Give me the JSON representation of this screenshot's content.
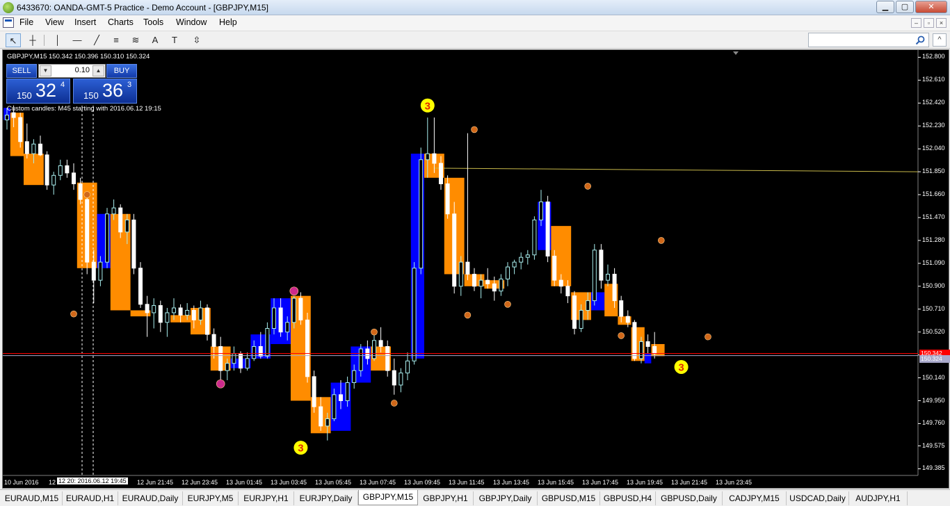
{
  "window": {
    "title": "6433670: OANDA-GMT-5 Practice - Demo Account - [GBPJPY,M15]",
    "min": "▁",
    "max": "▢",
    "close": "✕"
  },
  "menu": {
    "items": [
      "File",
      "View",
      "Insert",
      "Charts",
      "Tools",
      "Window",
      "Help"
    ],
    "mdi": [
      "–",
      "▫",
      "×"
    ]
  },
  "toolbar": {
    "tools": [
      "cursor-icon",
      "crosshair-icon",
      "vertical-line-icon",
      "horizontal-line-icon",
      "trendline-icon",
      "channel-icon",
      "fibonacci-icon",
      "text-icon",
      "label-icon",
      "arrows-icon"
    ],
    "tool_glyphs": [
      "↖",
      "┼",
      "│",
      "—",
      "╱",
      "≡",
      "≋",
      "A",
      "T",
      "⇳"
    ],
    "search_placeholder": "",
    "collapse": "^"
  },
  "chart": {
    "header": "GBPJPY,M15  150.342  150.396  150.310  150.324",
    "sell_label": "SELL",
    "buy_label": "BUY",
    "lot": "0.10",
    "sell_price": {
      "small": "150",
      "big": "32",
      "sup": "4"
    },
    "buy_price": {
      "small": "150",
      "big": "36",
      "sup": "3"
    },
    "custom_note": "Custom candles: M45 starting with 2016.06.12 19:15",
    "cursor_time": "12 20: 2016.06.12 19:45",
    "bid_tag": "150.342",
    "ask_tag": "150.324",
    "colors": {
      "background": "#000000",
      "bull_candle": "#aaf0f0",
      "bear_candle": "#ffffff",
      "bull_box": "#0000ff",
      "bear_box": "#ff8c00",
      "bid_line": "#ff0000",
      "ask_line": "#aaaacc",
      "level_line": "#c8b94a",
      "marker": "#d0681a",
      "pink_marker": "#cc2a8c",
      "wave_marker": "#ffff00"
    },
    "wave_labels": [
      "3",
      "3",
      "3"
    ]
  },
  "chart_data": {
    "type": "candlestick",
    "symbol": "GBPJPY",
    "timeframe": "M15",
    "y_ticks": [
      "152.800",
      "152.610",
      "152.420",
      "152.230",
      "152.040",
      "151.850",
      "151.660",
      "151.470",
      "151.280",
      "151.090",
      "150.900",
      "150.710",
      "150.520",
      "150.330",
      "150.140",
      "149.950",
      "149.760",
      "149.575",
      "149.385"
    ],
    "x_ticks": [
      "10 Jun 2016",
      "12 Jun 2016",
      "12 Jun 19:45",
      "12 Jun 21:45",
      "12 Jun 23:45",
      "13 Jun 01:45",
      "13 Jun 03:45",
      "13 Jun 05:45",
      "13 Jun 07:45",
      "13 Jun 09:45",
      "13 Jun 11:45",
      "13 Jun 13:45",
      "13 Jun 15:45",
      "13 Jun 17:45",
      "13 Jun 19:45",
      "13 Jun 21:45",
      "13 Jun 23:45"
    ],
    "ylim": [
      149.33,
      152.86
    ],
    "bid": 150.342,
    "ask": 150.324,
    "level": 151.85,
    "candles": [
      [
        152.28,
        152.38,
        152.2,
        152.32
      ],
      [
        152.34,
        152.4,
        152.22,
        152.3
      ],
      [
        152.3,
        152.34,
        152.05,
        152.1
      ],
      [
        152.1,
        152.25,
        151.96,
        152.0
      ],
      [
        152.0,
        152.12,
        151.92,
        152.08
      ],
      [
        152.08,
        152.15,
        151.98,
        151.99
      ],
      [
        151.99,
        152.02,
        151.7,
        151.74
      ],
      [
        151.74,
        151.85,
        151.66,
        151.82
      ],
      [
        151.82,
        151.95,
        151.78,
        151.9
      ],
      [
        151.9,
        151.95,
        151.8,
        151.84
      ],
      [
        151.84,
        151.92,
        151.7,
        151.75
      ],
      [
        151.75,
        151.8,
        151.58,
        151.62
      ],
      [
        151.62,
        151.66,
        151.0,
        151.1
      ],
      [
        151.1,
        151.2,
        150.76,
        150.95
      ],
      [
        150.95,
        151.15,
        150.9,
        151.1
      ],
      [
        151.1,
        151.55,
        151.05,
        151.5
      ],
      [
        151.5,
        151.62,
        151.45,
        151.55
      ],
      [
        151.55,
        151.58,
        151.3,
        151.35
      ],
      [
        151.35,
        151.5,
        151.25,
        151.45
      ],
      [
        151.45,
        151.5,
        151.0,
        151.05
      ],
      [
        151.05,
        151.1,
        150.72,
        150.75
      ],
      [
        150.75,
        150.82,
        150.48,
        150.68
      ],
      [
        150.68,
        150.8,
        150.55,
        150.74
      ],
      [
        150.74,
        150.78,
        150.52,
        150.6
      ],
      [
        150.6,
        150.72,
        150.48,
        150.68
      ],
      [
        150.68,
        150.8,
        150.62,
        150.72
      ],
      [
        150.72,
        150.75,
        150.6,
        150.66
      ],
      [
        150.66,
        150.76,
        150.62,
        150.7
      ],
      [
        150.7,
        150.74,
        150.55,
        150.62
      ],
      [
        150.62,
        150.78,
        150.58,
        150.72
      ],
      [
        150.72,
        150.75,
        150.45,
        150.5
      ],
      [
        150.5,
        150.55,
        150.3,
        150.4
      ],
      [
        150.4,
        150.48,
        150.12,
        150.2
      ],
      [
        150.2,
        150.3,
        150.12,
        150.26
      ],
      [
        150.26,
        150.4,
        150.2,
        150.34
      ],
      [
        150.34,
        150.36,
        150.18,
        150.22
      ],
      [
        150.22,
        150.35,
        150.2,
        150.3
      ],
      [
        150.3,
        150.45,
        150.28,
        150.4
      ],
      [
        150.4,
        150.52,
        150.3,
        150.32
      ],
      [
        150.32,
        150.6,
        150.3,
        150.55
      ],
      [
        150.55,
        150.8,
        150.5,
        150.72
      ],
      [
        150.72,
        150.8,
        150.48,
        150.52
      ],
      [
        150.52,
        150.65,
        150.45,
        150.6
      ],
      [
        150.6,
        150.82,
        150.55,
        150.8
      ],
      [
        150.8,
        150.85,
        150.58,
        150.62
      ],
      [
        150.62,
        150.68,
        150.1,
        150.15
      ],
      [
        150.15,
        150.2,
        149.85,
        149.9
      ],
      [
        149.9,
        149.98,
        149.7,
        149.74
      ],
      [
        149.74,
        149.85,
        149.62,
        149.8
      ],
      [
        149.8,
        150.05,
        149.78,
        150.0
      ],
      [
        150.0,
        150.12,
        149.88,
        149.95
      ],
      [
        149.95,
        150.15,
        149.9,
        150.1
      ],
      [
        150.1,
        150.25,
        150.05,
        150.2
      ],
      [
        150.2,
        150.42,
        150.15,
        150.38
      ],
      [
        150.38,
        150.45,
        150.25,
        150.3
      ],
      [
        150.3,
        150.5,
        150.28,
        150.45
      ],
      [
        150.45,
        150.56,
        150.35,
        150.4
      ],
      [
        150.4,
        150.45,
        150.15,
        150.2
      ],
      [
        150.2,
        150.3,
        150.0,
        150.08
      ],
      [
        150.08,
        150.22,
        150.02,
        150.18
      ],
      [
        150.18,
        150.35,
        150.12,
        150.28
      ],
      [
        150.28,
        151.1,
        150.25,
        151.05
      ],
      [
        151.05,
        152.05,
        151.0,
        151.95
      ],
      [
        151.95,
        152.3,
        151.8,
        152.0
      ],
      [
        152.0,
        152.3,
        151.84,
        151.92
      ],
      [
        151.92,
        151.98,
        151.7,
        151.75
      ],
      [
        151.75,
        151.82,
        151.46,
        151.5
      ],
      [
        151.5,
        151.6,
        150.84,
        150.9
      ],
      [
        150.9,
        151.15,
        150.82,
        151.1
      ],
      [
        151.1,
        152.17,
        150.95,
        151.0
      ],
      [
        151.0,
        151.05,
        150.86,
        150.9
      ],
      [
        150.9,
        151.0,
        150.8,
        150.95
      ],
      [
        150.95,
        151.05,
        150.88,
        150.92
      ],
      [
        150.92,
        150.98,
        150.78,
        150.86
      ],
      [
        150.86,
        151.0,
        150.82,
        150.96
      ],
      [
        150.96,
        151.1,
        150.9,
        151.06
      ],
      [
        151.06,
        151.12,
        151.0,
        151.1
      ],
      [
        151.1,
        151.18,
        151.04,
        151.14
      ],
      [
        151.14,
        151.2,
        151.08,
        151.16
      ],
      [
        151.16,
        151.48,
        151.12,
        151.45
      ],
      [
        151.45,
        151.7,
        151.4,
        151.6
      ],
      [
        151.6,
        151.65,
        151.1,
        151.15
      ],
      [
        151.15,
        151.2,
        150.9,
        150.95
      ],
      [
        150.95,
        151.0,
        150.84,
        150.9
      ],
      [
        150.9,
        150.95,
        150.76,
        150.82
      ],
      [
        150.82,
        150.86,
        150.5,
        150.55
      ],
      [
        150.55,
        150.75,
        150.52,
        150.7
      ],
      [
        150.7,
        150.85,
        150.62,
        150.78
      ],
      [
        150.78,
        151.25,
        150.74,
        151.2
      ],
      [
        151.2,
        151.25,
        150.88,
        150.95
      ],
      [
        150.95,
        151.08,
        150.9,
        151.0
      ],
      [
        151.0,
        151.05,
        150.72,
        150.78
      ],
      [
        150.78,
        150.82,
        150.6,
        150.65
      ],
      [
        150.65,
        150.7,
        150.56,
        150.6
      ],
      [
        150.6,
        150.62,
        150.28,
        150.3
      ],
      [
        150.3,
        150.48,
        150.26,
        150.44
      ],
      [
        150.44,
        150.5,
        150.34,
        150.4
      ],
      [
        150.4,
        150.52,
        150.3,
        150.34
      ]
    ],
    "boxes": [
      {
        "from": 0,
        "to": 0,
        "open": 152.28,
        "close": 152.38,
        "dir": "bull"
      },
      {
        "from": 1,
        "to": 2,
        "open": 152.34,
        "close": 151.98,
        "dir": "bear"
      },
      {
        "from": 3,
        "to": 5,
        "open": 152.0,
        "close": 151.74,
        "dir": "bear"
      },
      {
        "from": 11,
        "to": 13,
        "open": 151.76,
        "close": 151.05,
        "dir": "bear"
      },
      {
        "from": 14,
        "to": 15,
        "open": 151.05,
        "close": 151.5,
        "dir": "bull"
      },
      {
        "from": 16,
        "to": 18,
        "open": 151.5,
        "close": 150.7,
        "dir": "bear"
      },
      {
        "from": 19,
        "to": 21,
        "open": 150.7,
        "close": 150.65,
        "dir": "bear"
      },
      {
        "from": 25,
        "to": 27,
        "open": 150.66,
        "close": 150.6,
        "dir": "bear"
      },
      {
        "from": 28,
        "to": 30,
        "open": 150.72,
        "close": 150.5,
        "dir": "bear"
      },
      {
        "from": 31,
        "to": 33,
        "open": 150.4,
        "close": 150.2,
        "dir": "bear"
      },
      {
        "from": 34,
        "to": 36,
        "open": 150.22,
        "close": 150.3,
        "dir": "bull"
      },
      {
        "from": 37,
        "to": 39,
        "open": 150.3,
        "close": 150.5,
        "dir": "bull"
      },
      {
        "from": 40,
        "to": 42,
        "open": 150.42,
        "close": 150.8,
        "dir": "bull"
      },
      {
        "from": 43,
        "to": 45,
        "open": 150.82,
        "close": 149.95,
        "dir": "bear"
      },
      {
        "from": 46,
        "to": 48,
        "open": 149.98,
        "close": 149.68,
        "dir": "bear"
      },
      {
        "from": 49,
        "to": 51,
        "open": 149.7,
        "close": 150.1,
        "dir": "bull"
      },
      {
        "from": 52,
        "to": 54,
        "open": 150.1,
        "close": 150.4,
        "dir": "bull"
      },
      {
        "from": 55,
        "to": 57,
        "open": 150.4,
        "close": 150.2,
        "dir": "bear"
      },
      {
        "from": 61,
        "to": 62,
        "open": 150.3,
        "close": 152.0,
        "dir": "bull"
      },
      {
        "from": 63,
        "to": 65,
        "open": 152.0,
        "close": 151.8,
        "dir": "bear"
      },
      {
        "from": 66,
        "to": 68,
        "open": 151.8,
        "close": 151.0,
        "dir": "bear"
      },
      {
        "from": 69,
        "to": 71,
        "open": 151.0,
        "close": 150.9,
        "dir": "bear"
      },
      {
        "from": 72,
        "to": 74,
        "open": 150.95,
        "close": 150.88,
        "dir": "bear"
      },
      {
        "from": 80,
        "to": 81,
        "open": 151.2,
        "close": 151.6,
        "dir": "bull"
      },
      {
        "from": 82,
        "to": 84,
        "open": 151.4,
        "close": 150.9,
        "dir": "bear"
      },
      {
        "from": 85,
        "to": 87,
        "open": 150.85,
        "close": 150.62,
        "dir": "bear"
      },
      {
        "from": 88,
        "to": 89,
        "open": 150.7,
        "close": 150.85,
        "dir": "bull"
      },
      {
        "from": 90,
        "to": 91,
        "open": 150.92,
        "close": 150.65,
        "dir": "bear"
      },
      {
        "from": 92,
        "to": 93,
        "open": 150.65,
        "close": 150.58,
        "dir": "bear"
      },
      {
        "from": 94,
        "to": 95,
        "open": 150.56,
        "close": 150.28,
        "dir": "bear"
      },
      {
        "from": 96,
        "to": 96,
        "open": 150.26,
        "close": 150.34,
        "dir": "bull"
      },
      {
        "from": 97,
        "to": 98,
        "open": 150.42,
        "close": 150.32,
        "dir": "bear"
      }
    ],
    "markers": [
      {
        "index": 12,
        "value": 151.66,
        "kind": "orange"
      },
      {
        "index": 10,
        "value": 150.67,
        "kind": "orange"
      },
      {
        "index": 32,
        "value": 150.09,
        "kind": "pink"
      },
      {
        "index": 43,
        "value": 150.86,
        "kind": "pink"
      },
      {
        "index": 55,
        "value": 150.52,
        "kind": "orange"
      },
      {
        "index": 58,
        "value": 149.93,
        "kind": "orange"
      },
      {
        "index": 70,
        "value": 152.2,
        "kind": "orange"
      },
      {
        "index": 69,
        "value": 150.66,
        "kind": "orange"
      },
      {
        "index": 75,
        "value": 150.75,
        "kind": "orange"
      },
      {
        "index": 87,
        "value": 151.73,
        "kind": "orange"
      },
      {
        "index": 92,
        "value": 150.49,
        "kind": "orange"
      },
      {
        "index": 98,
        "value": 151.28,
        "kind": "orange"
      },
      {
        "index": 105,
        "value": 150.48,
        "kind": "orange"
      }
    ],
    "wave_points": [
      {
        "index": 44,
        "value": 149.56
      },
      {
        "index": 63,
        "value": 152.4
      },
      {
        "index": 101,
        "value": 150.23
      }
    ]
  },
  "tabs": {
    "active": 6,
    "items": [
      "EURAUD,M15",
      "EURAUD,H1",
      "EURAUD,Daily",
      "EURJPY,M5",
      "EURJPY,H1",
      "EURJPY,Daily",
      "GBPJPY,M15",
      "GBPJPY,H1",
      "GBPJPY,Daily",
      "GBPUSD,M15",
      "GBPUSD,H4",
      "GBPUSD,Daily",
      "CADJPY,M15",
      "USDCAD,Daily",
      "AUDJPY,H1"
    ]
  }
}
